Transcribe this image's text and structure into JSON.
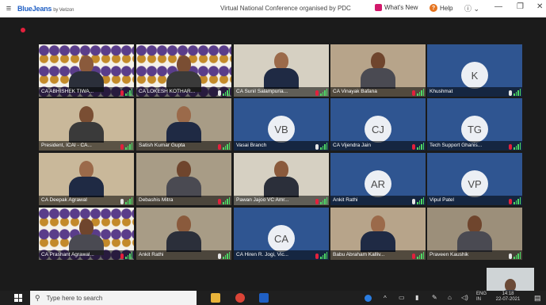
{
  "titlebar": {
    "menu_icon": "hamburger-icon",
    "brand": "BlueJeans",
    "brand_suffix": "by Verizon",
    "window_title": "Virtual National Conference organised by PDC",
    "whats_new": "What's New",
    "help": "Help",
    "help_glyph": "?",
    "user_icon": "user-icon",
    "minimize": "—",
    "maximize": "❐",
    "close": "✕"
  },
  "tiles": [
    {
      "name": "CA ABHISHEK TIWA...",
      "kind": "video",
      "scene": "emblem"
    },
    {
      "name": "CA LOKESH KOTHAR...",
      "kind": "video",
      "scene": "emblem"
    },
    {
      "name": "CA Sunil Salampuria...",
      "kind": "video",
      "scene": "room"
    },
    {
      "name": "CA Vinayak Bafana",
      "kind": "video",
      "scene": "room"
    },
    {
      "name": "Khushmat",
      "kind": "avatar",
      "initials": "K"
    },
    {
      "name": "President, ICAI - CA...",
      "kind": "video",
      "scene": "room"
    },
    {
      "name": "Satish Kumar Gupta",
      "kind": "video",
      "scene": "room"
    },
    {
      "name": "Vasai Branch",
      "kind": "avatar",
      "initials": "VB"
    },
    {
      "name": "CA Vijendra Jain",
      "kind": "avatar",
      "initials": "CJ"
    },
    {
      "name": "Tech Support Ghanis...",
      "kind": "avatar",
      "initials": "TG"
    },
    {
      "name": "CA Deepak Agrawal",
      "kind": "video",
      "scene": "room"
    },
    {
      "name": "Debashis Mitra",
      "kind": "video",
      "scene": "room"
    },
    {
      "name": "Pawan Jajoo VC Amr...",
      "kind": "video",
      "scene": "room"
    },
    {
      "name": "Ankit Rathi",
      "kind": "avatar",
      "initials": "AR"
    },
    {
      "name": "Vipul Patel",
      "kind": "avatar",
      "initials": "VP"
    },
    {
      "name": "CA Prashant Agrawal...",
      "kind": "video",
      "scene": "emblem"
    },
    {
      "name": "Ankit Rathi",
      "kind": "video",
      "scene": "room"
    },
    {
      "name": "CA Hiren R. Jogi, Vic...",
      "kind": "avatar",
      "initials": "CA"
    },
    {
      "name": "Babu Abraham Kalliv...",
      "kind": "video",
      "scene": "room"
    },
    {
      "name": "Praveen Kaushik",
      "kind": "video",
      "scene": "room"
    }
  ],
  "taskbar": {
    "search_placeholder": "Type here to search",
    "lang": "ENG",
    "lang_sub": "IN",
    "time": "14:18",
    "date": "22-07-2021"
  },
  "colors": {
    "brand": "#1f5fc4",
    "tile_blue": "#2f5591",
    "active_border": "#39c75a",
    "muted": "#e3203c",
    "signal": "#4cd964"
  }
}
